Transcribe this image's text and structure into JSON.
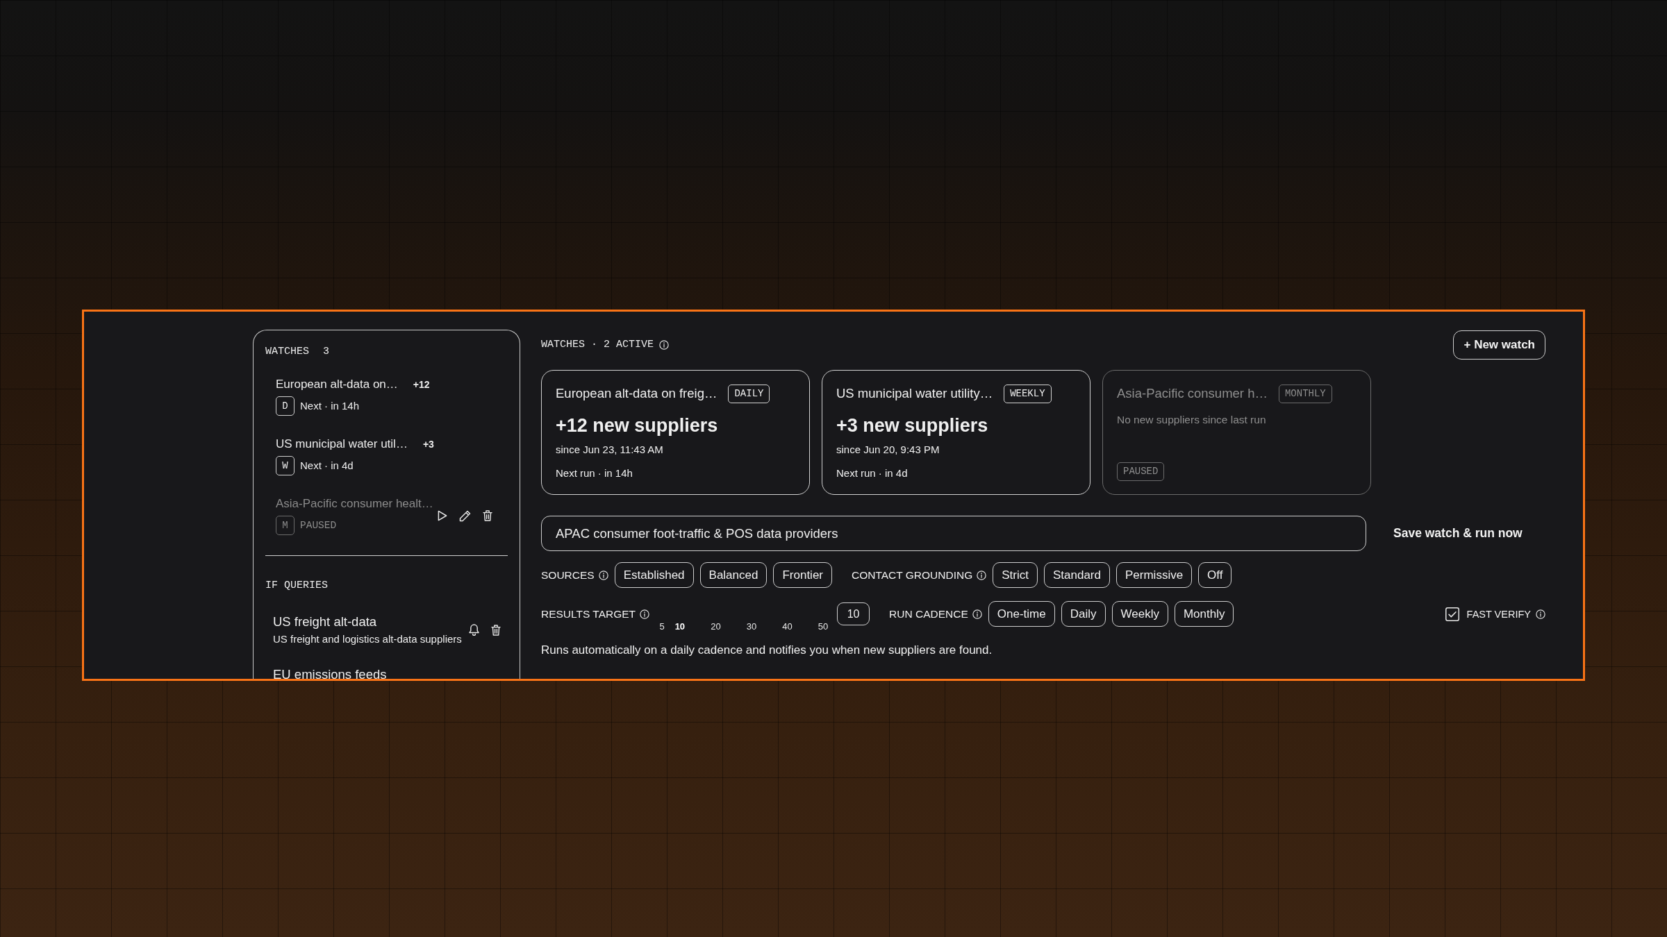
{
  "sidebar": {
    "watches_heading": "WATCHES",
    "watches_count": "3",
    "watches": [
      {
        "title": "European alt-data on…",
        "count": "+12",
        "cadence": "D",
        "meta": "Next · in 14h",
        "paused": false,
        "show_actions": false
      },
      {
        "title": "US municipal water util…",
        "count": "+3",
        "cadence": "W",
        "meta": "Next · in 4d",
        "paused": false,
        "show_actions": false
      },
      {
        "title": "Asia-Pacific consumer healt…",
        "cadence": "M",
        "meta": "PAUSED",
        "paused": true,
        "show_actions": true
      }
    ],
    "queries_heading": "IF QUERIES",
    "queries": [
      {
        "title": "US freight alt-data",
        "description": "US freight and logistics alt-data suppliers",
        "show_actions": true
      },
      {
        "title": "EU emissions feeds",
        "show_actions": false
      }
    ]
  },
  "header": {
    "title": "WATCHES · 2 ACTIVE",
    "new_watch_button": "+ New watch"
  },
  "cards": [
    {
      "title": "European alt-data on freig…",
      "cadence": "DAILY",
      "headline": "+12 new suppliers",
      "since": "since Jun 23, 11:43 AM",
      "next_run": "Next run · in 14h",
      "paused": false
    },
    {
      "title": "US municipal water utility…",
      "cadence": "WEEKLY",
      "headline": "+3 new suppliers",
      "since": "since Jun 20, 9:43 PM",
      "next_run": "Next run · in 4d",
      "paused": false
    },
    {
      "title": "Asia-Pacific consumer h…",
      "cadence": "MONTHLY",
      "note": "No new suppliers since last run",
      "status": "PAUSED",
      "paused": true
    }
  ],
  "query_field": {
    "value": "APAC consumer foot-traffic & POS data providers"
  },
  "save_button": "Save watch & run now",
  "sources": {
    "label": "SOURCES",
    "options": [
      {
        "label": "Established",
        "selected": false
      },
      {
        "label": "Balanced",
        "selected": false
      },
      {
        "label": "Frontier",
        "selected": false
      }
    ]
  },
  "contact_grounding": {
    "label": "CONTACT GROUNDING",
    "options": [
      {
        "label": "Strict",
        "selected": false
      },
      {
        "label": "Standard",
        "selected": false
      },
      {
        "label": "Permissive",
        "selected": false
      },
      {
        "label": "Off",
        "selected": false
      }
    ]
  },
  "results_target": {
    "label": "RESULTS TARGET",
    "ticks": [
      {
        "label": "5",
        "selected": false
      },
      {
        "label": "10",
        "selected": true
      },
      {
        "label": "20",
        "selected": false
      },
      {
        "label": "30",
        "selected": false
      },
      {
        "label": "40",
        "selected": false
      },
      {
        "label": "50",
        "selected": false
      }
    ],
    "value": "10"
  },
  "run_cadence": {
    "label": "RUN CADENCE",
    "options": [
      {
        "label": "One-time",
        "selected": false
      },
      {
        "label": "Daily",
        "selected": false
      },
      {
        "label": "Weekly",
        "selected": false
      },
      {
        "label": "Monthly",
        "selected": false
      }
    ]
  },
  "fast_verify": {
    "label": "FAST VERIFY",
    "checked": true
  },
  "description": "Runs automatically on a daily cadence and notifies you when new suppliers are found."
}
